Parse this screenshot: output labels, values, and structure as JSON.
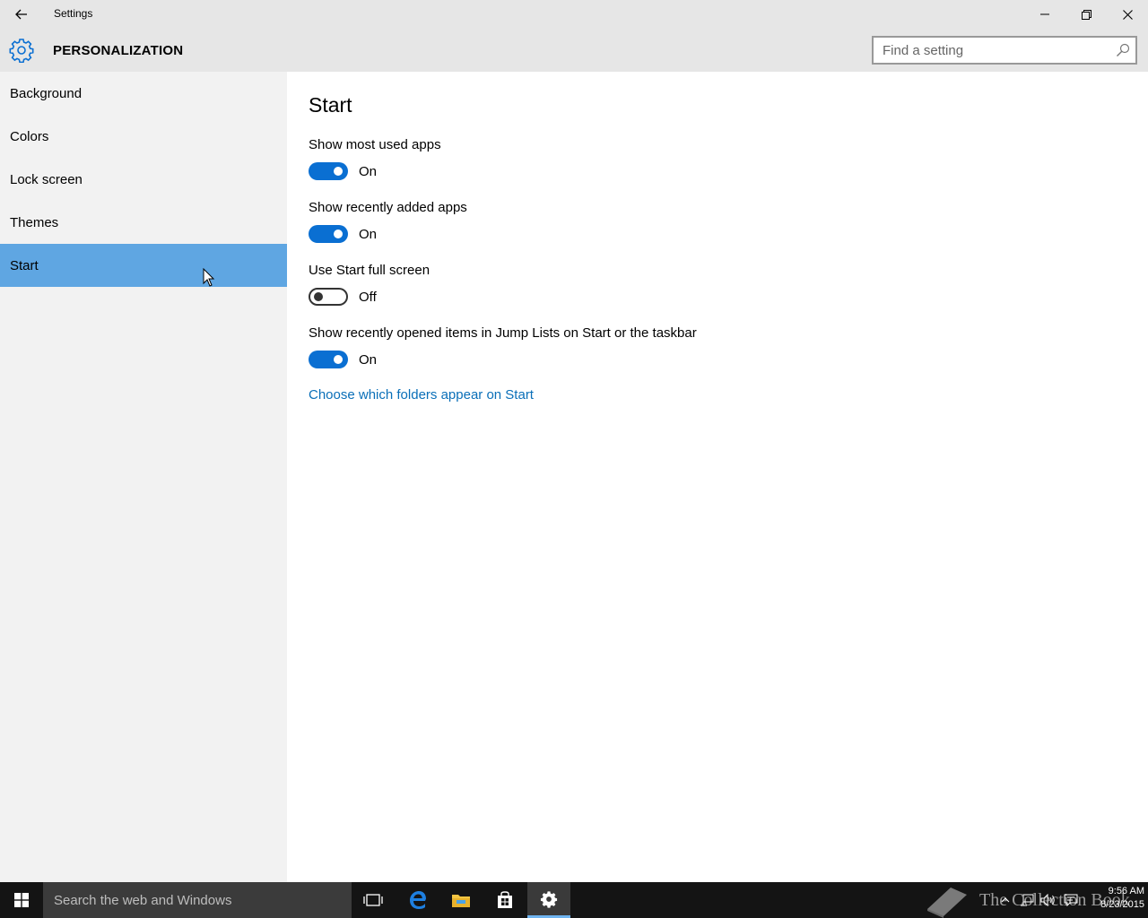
{
  "window": {
    "title": "Settings"
  },
  "header": {
    "section": "PERSONALIZATION",
    "search_placeholder": "Find a setting"
  },
  "sidebar": {
    "items": [
      {
        "label": "Background"
      },
      {
        "label": "Colors"
      },
      {
        "label": "Lock screen"
      },
      {
        "label": "Themes"
      },
      {
        "label": "Start",
        "selected": true
      }
    ]
  },
  "main": {
    "heading": "Start",
    "settings": [
      {
        "label": "Show most used apps",
        "state": "On"
      },
      {
        "label": "Show recently added apps",
        "state": "On"
      },
      {
        "label": "Use Start full screen",
        "state": "Off"
      },
      {
        "label": "Show recently opened items in Jump Lists on Start or the taskbar",
        "state": "On"
      }
    ],
    "link": "Choose which folders appear on Start"
  },
  "taskbar": {
    "search_placeholder": "Search the web and Windows",
    "time": "9:56 AM",
    "date": "8/23/2015",
    "watermark": "The Collection Book"
  },
  "colors": {
    "accent": "#0a6fd2",
    "selected_nav": "#5fa6e2",
    "link": "#0a6fb8"
  },
  "icons": [
    "back-arrow-icon",
    "minimize-icon",
    "maximize-icon",
    "close-icon",
    "gear-icon",
    "search-icon",
    "windows-logo-icon",
    "task-view-icon",
    "edge-icon",
    "file-explorer-icon",
    "store-icon",
    "settings-gear-icon",
    "chevron-up-icon",
    "network-icon",
    "volume-icon",
    "action-center-icon",
    "mouse-cursor-icon"
  ]
}
